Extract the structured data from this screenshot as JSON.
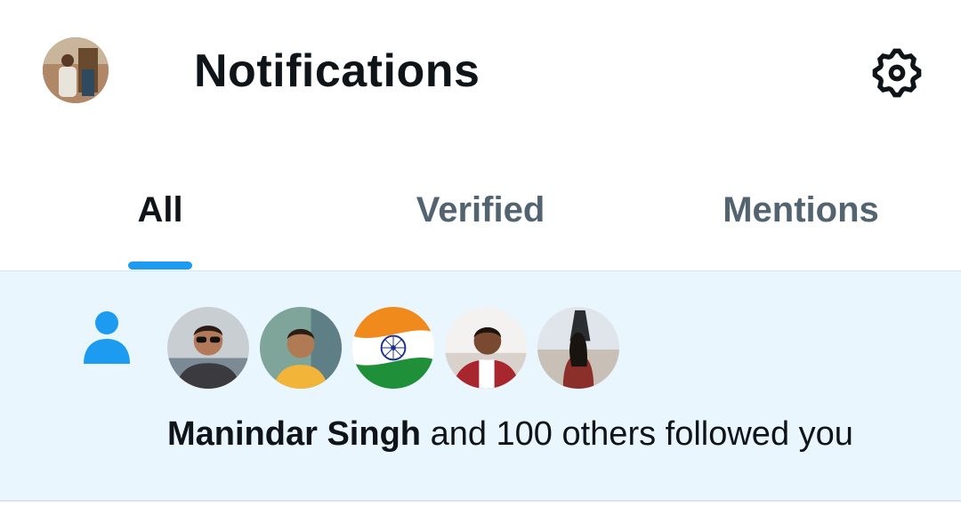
{
  "header": {
    "title": "Notifications",
    "profile_avatar": "user-avatar",
    "settings_icon": "gear-icon"
  },
  "tabs": [
    {
      "label": "All",
      "active": true
    },
    {
      "label": "Verified",
      "active": false
    },
    {
      "label": "Mentions",
      "active": false
    }
  ],
  "notification": {
    "type_icon": "person-icon",
    "actor_name": "Manindar Singh",
    "message": "and 100 others followed you",
    "follower_avatars": [
      "follower-avatar",
      "follower-avatar",
      "indian-flag-avatar",
      "follower-avatar",
      "follower-avatar"
    ]
  },
  "colors": {
    "accent": "#1d9bf0",
    "highlight_background": "#eaf6fd",
    "primary_text": "#0f1419",
    "secondary_text": "#536471"
  }
}
